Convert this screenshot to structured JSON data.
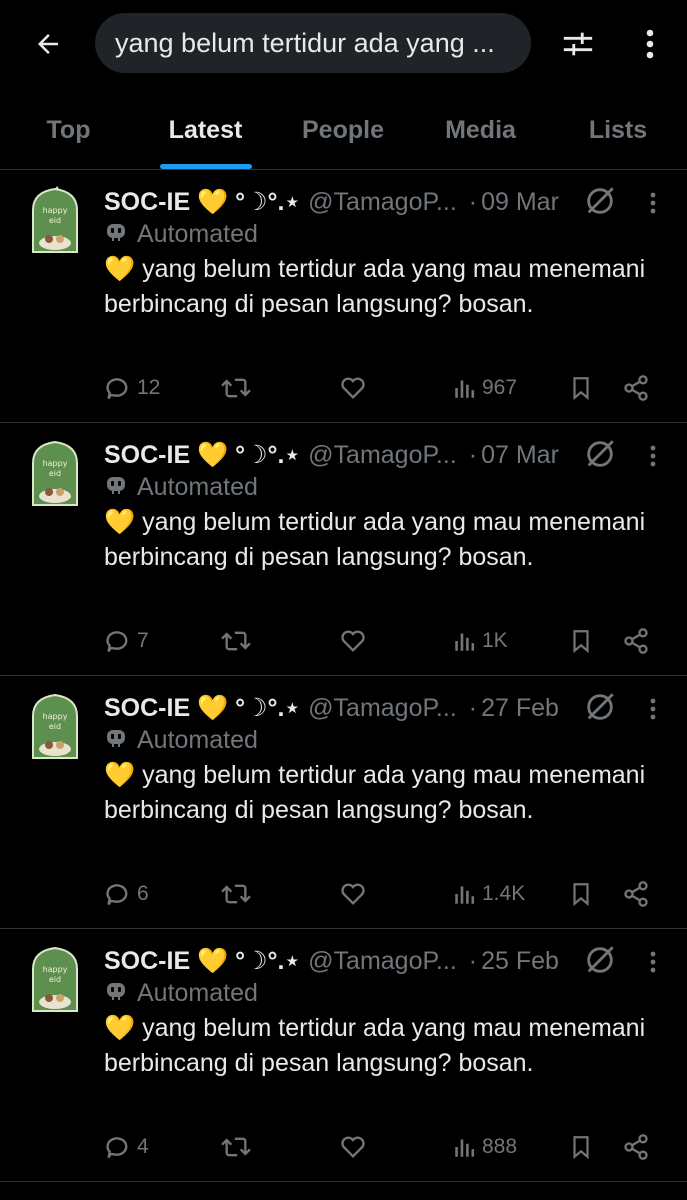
{
  "search": {
    "query": "yang belum tertidur ada yang ..."
  },
  "tabs": [
    {
      "label": "Top"
    },
    {
      "label": "Latest",
      "active": true
    },
    {
      "label": "People"
    },
    {
      "label": "Media"
    },
    {
      "label": "Lists"
    }
  ],
  "tweets": [
    {
      "display_name": "SOC-IE 💛 °☽°.⋆",
      "handle": "@TamagoP...",
      "date": "09 Mar",
      "automated_label": "Automated",
      "text": "💛 yang belum tertidur ada yang mau menemani berbincang di pesan langsung? bosan.",
      "replies": "12",
      "views": "967"
    },
    {
      "display_name": "SOC-IE 💛 °☽°.⋆",
      "handle": "@TamagoP...",
      "date": "07 Mar",
      "automated_label": "Automated",
      "text": "💛 yang belum tertidur ada yang mau menemani berbincang di pesan langsung? bosan.",
      "replies": "7",
      "views": "1K"
    },
    {
      "display_name": "SOC-IE 💛 °☽°.⋆",
      "handle": "@TamagoP...",
      "date": "27 Feb",
      "automated_label": "Automated",
      "text": "💛 yang belum tertidur ada yang mau menemani berbincang di pesan langsung? bosan.",
      "replies": "6",
      "views": "1.4K"
    },
    {
      "display_name": "SOC-IE 💛 °☽°.⋆",
      "handle": "@TamagoP...",
      "date": "25 Feb",
      "automated_label": "Automated",
      "text": "💛 yang belum tertidur ada yang mau menemani berbincang di pesan langsung? bosan.",
      "replies": "4",
      "views": "888"
    }
  ],
  "colors": {
    "background": "#000000",
    "text": "#e7e9ea",
    "muted": "#71767b",
    "accent": "#1d9bf0",
    "divider": "#2f3336",
    "search_bg": "#202327"
  },
  "icons": {
    "back": "arrow-left-icon",
    "filter": "sliders-icon",
    "more": "vertical-dots-icon",
    "reply": "comment-icon",
    "repost": "repost-icon",
    "like": "heart-icon",
    "views": "bar-chart-icon",
    "bookmark": "bookmark-icon",
    "share": "share-icon",
    "mute": "mute-icon",
    "bot": "robot-icon"
  }
}
